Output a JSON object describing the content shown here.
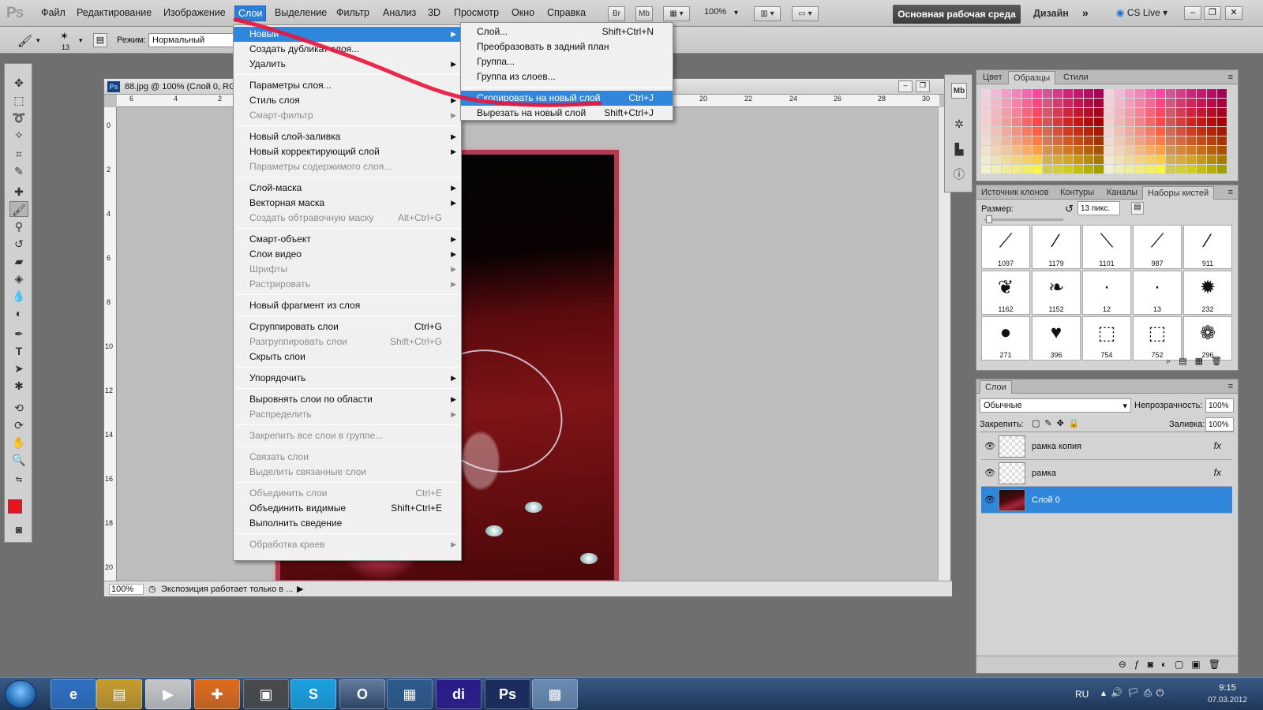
{
  "app": {
    "logo": "Ps"
  },
  "menubar": {
    "items": [
      "Файл",
      "Редактирование",
      "Изображение",
      "Слои",
      "Выделение",
      "Фильтр",
      "Анализ",
      "3D",
      "Просмотр",
      "Окно",
      "Справка"
    ],
    "bridge_label": "Br",
    "minibridge_label": "Mb",
    "zoom": "100%",
    "workspace_button": "Основная рабочая среда",
    "design_label": "Дизайн",
    "cslive_label": "CS Live"
  },
  "options": {
    "brush_size": "13",
    "mode_label": "Режим:",
    "mode_value": "Нормальный"
  },
  "document": {
    "title": "88.jpg @ 100% (Слой 0, RG",
    "ps_icon": "Ps",
    "zoom": "100%",
    "status": "Экспозиция работает только в ...",
    "ruler_top_ticks": [
      "6",
      "4",
      "2",
      "20",
      "22",
      "24",
      "26",
      "28",
      "30"
    ],
    "ruler_left_ticks": [
      "0",
      "2",
      "4",
      "6",
      "8",
      "10",
      "12",
      "14",
      "16",
      "18",
      "20"
    ]
  },
  "layer_menu": {
    "items": [
      {
        "label": "Новый",
        "shortcut": "",
        "submenu": true,
        "disabled": false,
        "highlight": true
      },
      {
        "label": "Создать дубликат слоя...",
        "shortcut": "",
        "submenu": false,
        "disabled": false
      },
      {
        "label": "Удалить",
        "shortcut": "",
        "submenu": true,
        "disabled": false
      },
      {
        "sep": true
      },
      {
        "label": "Параметры слоя...",
        "shortcut": "",
        "submenu": false,
        "disabled": false
      },
      {
        "label": "Стиль слоя",
        "shortcut": "",
        "submenu": true,
        "disabled": false
      },
      {
        "label": "Смарт-фильтр",
        "shortcut": "",
        "submenu": true,
        "disabled": true
      },
      {
        "sep": true
      },
      {
        "label": "Новый слой-заливка",
        "shortcut": "",
        "submenu": true,
        "disabled": false
      },
      {
        "label": "Новый корректирующий слой",
        "shortcut": "",
        "submenu": true,
        "disabled": false
      },
      {
        "label": "Параметры содержимого слоя...",
        "shortcut": "",
        "submenu": false,
        "disabled": true
      },
      {
        "sep": true
      },
      {
        "label": "Слой-маска",
        "shortcut": "",
        "submenu": true,
        "disabled": false
      },
      {
        "label": "Векторная маска",
        "shortcut": "",
        "submenu": true,
        "disabled": false
      },
      {
        "label": "Создать обтравочную маску",
        "shortcut": "Alt+Ctrl+G",
        "submenu": false,
        "disabled": true
      },
      {
        "sep": true
      },
      {
        "label": "Смарт-объект",
        "shortcut": "",
        "submenu": true,
        "disabled": false
      },
      {
        "label": "Слои видео",
        "shortcut": "",
        "submenu": true,
        "disabled": false
      },
      {
        "label": "Шрифты",
        "shortcut": "",
        "submenu": true,
        "disabled": true
      },
      {
        "label": "Растрировать",
        "shortcut": "",
        "submenu": true,
        "disabled": true
      },
      {
        "sep": true
      },
      {
        "label": "Новый фрагмент из слоя",
        "shortcut": "",
        "submenu": false,
        "disabled": false
      },
      {
        "sep": true
      },
      {
        "label": "Сгруппировать слои",
        "shortcut": "Ctrl+G",
        "submenu": false,
        "disabled": false
      },
      {
        "label": "Разгруппировать слои",
        "shortcut": "Shift+Ctrl+G",
        "submenu": false,
        "disabled": true
      },
      {
        "label": "Скрыть слои",
        "shortcut": "",
        "submenu": false,
        "disabled": false
      },
      {
        "sep": true
      },
      {
        "label": "Упорядочить",
        "shortcut": "",
        "submenu": true,
        "disabled": false
      },
      {
        "sep": true
      },
      {
        "label": "Выровнять слои по области",
        "shortcut": "",
        "submenu": true,
        "disabled": false
      },
      {
        "label": "Распределить",
        "shortcut": "",
        "submenu": true,
        "disabled": true
      },
      {
        "sep": true
      },
      {
        "label": "Закрепить все слои в группе...",
        "shortcut": "",
        "submenu": false,
        "disabled": true
      },
      {
        "sep": true
      },
      {
        "label": "Связать слои",
        "shortcut": "",
        "submenu": false,
        "disabled": true
      },
      {
        "label": "Выделить связанные слои",
        "shortcut": "",
        "submenu": false,
        "disabled": true
      },
      {
        "sep": true
      },
      {
        "label": "Объединить слои",
        "shortcut": "Ctrl+E",
        "submenu": false,
        "disabled": true
      },
      {
        "label": "Объединить видимые",
        "shortcut": "Shift+Ctrl+E",
        "submenu": false,
        "disabled": false
      },
      {
        "label": "Выполнить сведение",
        "shortcut": "",
        "submenu": false,
        "disabled": false
      },
      {
        "sep": true
      },
      {
        "label": "Обработка краев",
        "shortcut": "",
        "submenu": true,
        "disabled": true
      }
    ]
  },
  "new_submenu": {
    "items": [
      {
        "label": "Слой...",
        "shortcut": "Shift+Ctrl+N",
        "highlight": false
      },
      {
        "label": "Преобразовать в задний план",
        "shortcut": "",
        "highlight": false
      },
      {
        "label": "Группа...",
        "shortcut": "",
        "highlight": false
      },
      {
        "label": "Группа из слоев...",
        "shortcut": "",
        "highlight": false
      },
      {
        "sep": true
      },
      {
        "label": "Скопировать на новый слой",
        "shortcut": "Ctrl+J",
        "highlight": true
      },
      {
        "label": "Вырезать на новый слой",
        "shortcut": "Shift+Ctrl+J",
        "highlight": false
      }
    ]
  },
  "swatches_panel": {
    "tabs": [
      "Цвет",
      "Образцы",
      "Стили"
    ],
    "active_tab": "Образцы"
  },
  "brushes_panel": {
    "tabs": [
      "Источник клонов",
      "Контуры",
      "Каналы",
      "Наборы кистей"
    ],
    "size_label": "Размер:",
    "size_value": "13 пикс.",
    "brushes": [
      "1097",
      "1179",
      "1101",
      "987",
      "911",
      "1162",
      "1152",
      "12",
      "13",
      "232",
      "271",
      "396",
      "754",
      "752",
      "296"
    ]
  },
  "layers_panel": {
    "tab": "Слои",
    "blend_mode": "Обычные",
    "opacity_label": "Непрозрачность:",
    "opacity_value": "100%",
    "lock_label": "Закрепить:",
    "fill_label": "Заливка:",
    "fill_value": "100%",
    "layers": [
      {
        "name": "рамка копия",
        "fx": "fx",
        "selected": false
      },
      {
        "name": "рамка",
        "fx": "fx",
        "selected": false
      },
      {
        "name": "Слой 0",
        "fx": "",
        "selected": true
      }
    ]
  },
  "taskbar": {
    "lang": "RU",
    "time": "9:15",
    "date": "07.03.2012",
    "apps": [
      "e",
      "▤",
      "▶",
      "✚",
      "▣",
      "S",
      "O",
      "▦",
      "di",
      "Ps",
      "▩"
    ]
  },
  "colors": {
    "accent": "#2f86db",
    "foreground_swatch": "#e8141b",
    "background_swatch": "#8d1a1a",
    "annotation_stroke": "#e8143c"
  }
}
